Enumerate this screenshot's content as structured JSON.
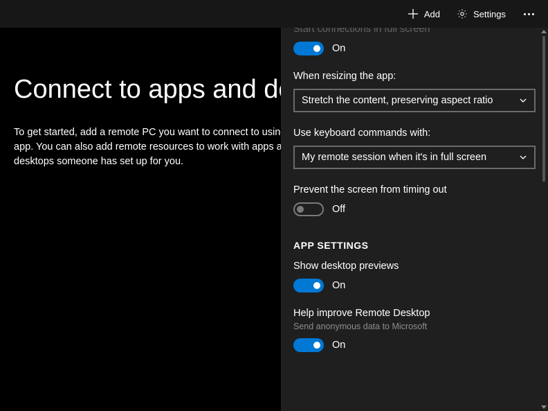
{
  "titlebar": {
    "add_label": "Add",
    "settings_label": "Settings"
  },
  "main": {
    "title": "Connect to apps and desktops",
    "body": "To get started, add a remote PC you want to connect to using this app. You can also add remote resources to work with apps and desktops someone has set up for you."
  },
  "panel": {
    "cut_label": "Start connections in full screen",
    "fullscreen_toggle_state": "On",
    "resize_label": "When resizing the app:",
    "resize_value": "Stretch the content, preserving aspect ratio",
    "keyboard_label": "Use keyboard commands with:",
    "keyboard_value": "My remote session when it's in full screen",
    "timeout_label": "Prevent the screen from timing out",
    "timeout_state": "Off",
    "section_header": "APP SETTINGS",
    "previews_label": "Show desktop previews",
    "previews_state": "On",
    "improve_label": "Help improve Remote Desktop",
    "improve_sub": "Send anonymous data to Microsoft",
    "improve_state": "On"
  }
}
